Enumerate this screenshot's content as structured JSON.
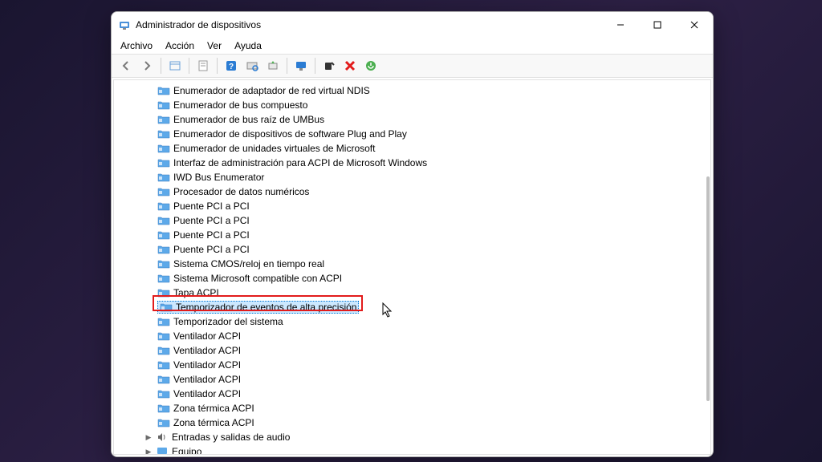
{
  "title": "Administrador de dispositivos",
  "menu": [
    "Archivo",
    "Acción",
    "Ver",
    "Ayuda"
  ],
  "tree": {
    "devices": [
      "Enumerador de adaptador de red virtual NDIS",
      "Enumerador de bus compuesto",
      "Enumerador de bus raíz de UMBus",
      "Enumerador de dispositivos de software Plug and Play",
      "Enumerador de unidades virtuales de Microsoft",
      "Interfaz de administración para ACPI de Microsoft Windows",
      "IWD Bus Enumerator",
      "Procesador de datos numéricos",
      "Puente PCI a PCI",
      "Puente PCI a PCI",
      "Puente PCI a PCI",
      "Puente PCI a PCI",
      "Sistema CMOS/reloj en tiempo real",
      "Sistema Microsoft compatible con ACPI",
      "Tapa ACPI",
      "Temporizador de eventos de alta precisión",
      "Temporizador del sistema",
      "Ventilador ACPI",
      "Ventilador ACPI",
      "Ventilador ACPI",
      "Ventilador ACPI",
      "Ventilador ACPI",
      "Zona térmica ACPI",
      "Zona térmica ACPI"
    ],
    "selectedIndex": 15,
    "categories": [
      {
        "label": "Entradas y salidas de audio",
        "icon": "speaker"
      },
      {
        "label": "Equipo",
        "icon": "monitor"
      }
    ]
  },
  "highlight": {
    "visible": true
  }
}
